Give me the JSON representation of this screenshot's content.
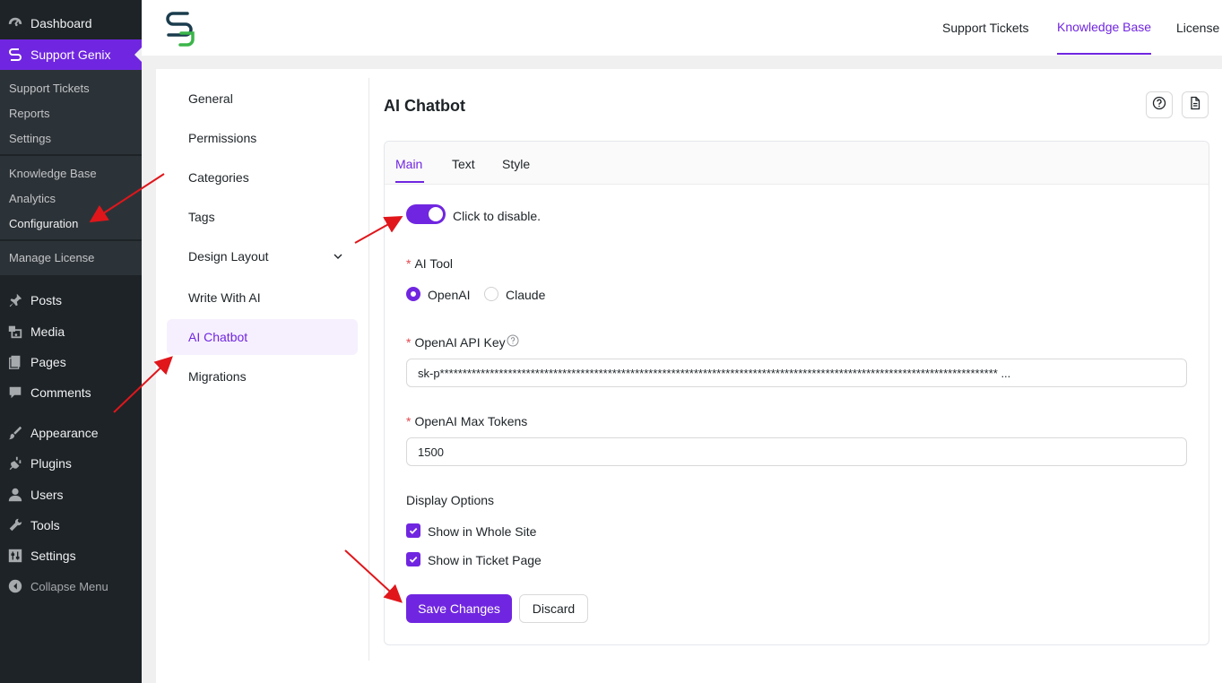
{
  "wp_menu": {
    "dashboard": "Dashboard",
    "support_genix": "Support Genix",
    "sub_support_tickets": "Support Tickets",
    "sub_reports": "Reports",
    "sub_settings": "Settings",
    "sub_knowledge_base": "Knowledge Base",
    "sub_analytics": "Analytics",
    "sub_configuration": "Configuration",
    "sub_manage_license": "Manage License",
    "posts": "Posts",
    "media": "Media",
    "pages": "Pages",
    "comments": "Comments",
    "appearance": "Appearance",
    "plugins": "Plugins",
    "users": "Users",
    "tools": "Tools",
    "settings": "Settings",
    "collapse": "Collapse Menu"
  },
  "header": {
    "tabs": [
      "Support Tickets",
      "Knowledge Base",
      "License"
    ],
    "active_tab": "Knowledge Base"
  },
  "settings_nav": {
    "items": [
      "General",
      "Permissions",
      "Categories",
      "Tags",
      "Design Layout",
      "Write With AI",
      "AI Chatbot",
      "Migrations"
    ],
    "active": "AI Chatbot"
  },
  "page": {
    "title": "AI Chatbot",
    "tabs": [
      "Main",
      "Text",
      "Style"
    ],
    "active_tab": "Main",
    "toggle_label": "Click to disable.",
    "ai_tool_label": "AI Tool",
    "ai_tool_options": [
      "OpenAI",
      "Claude"
    ],
    "ai_tool_selected": "OpenAI",
    "api_key_label": "OpenAI API Key",
    "api_key_value": "sk-p*************************************************************************************************************************** ...",
    "max_tokens_label": "OpenAI Max Tokens",
    "max_tokens_value": "1500",
    "display_options_label": "Display Options",
    "display_options": [
      "Show in Whole Site",
      "Show in Ticket Page"
    ],
    "save_label": "Save Changes",
    "discard_label": "Discard"
  },
  "colors": {
    "accent": "#7026e0",
    "wp_sidebar": "#1d2327",
    "annotation_arrow": "#e0161b"
  }
}
